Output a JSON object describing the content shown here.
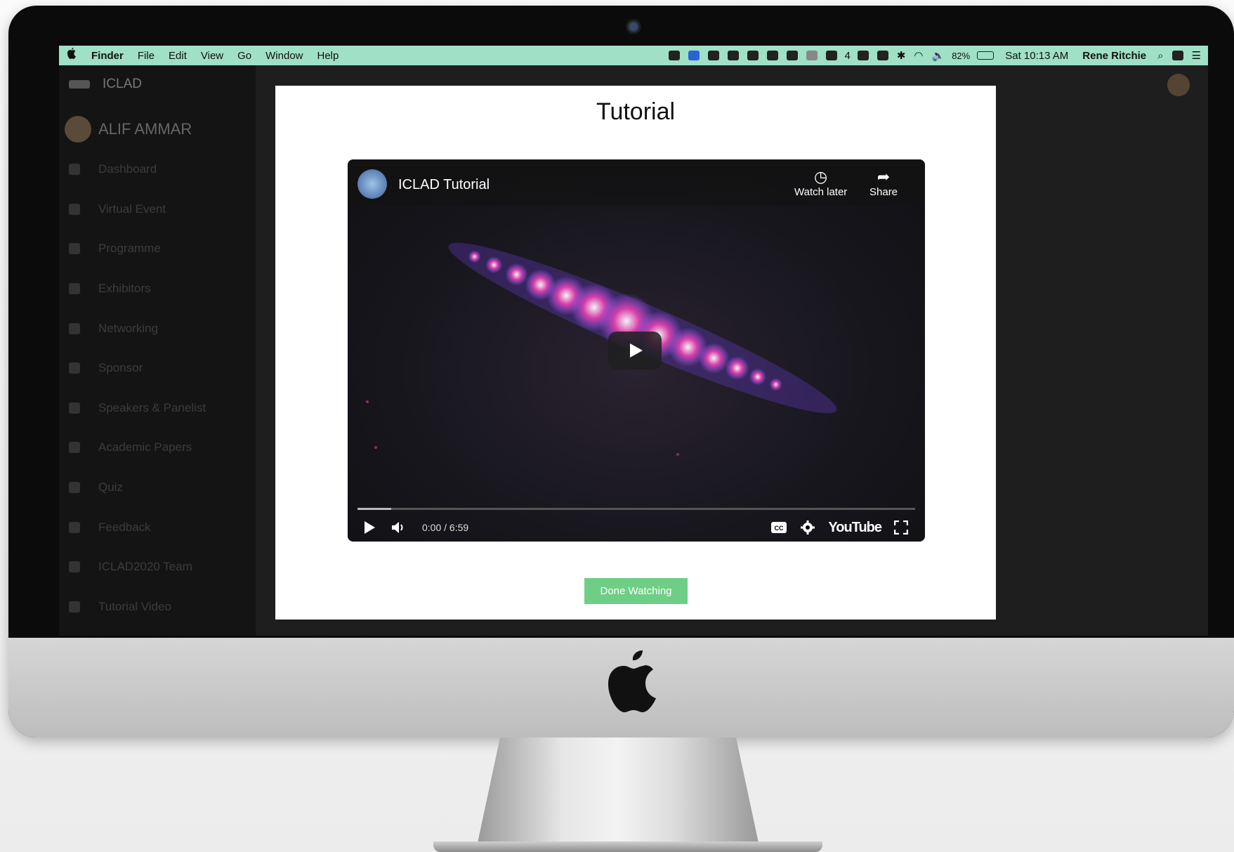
{
  "menubar": {
    "apple": "",
    "items": [
      "Finder",
      "File",
      "Edit",
      "View",
      "Go",
      "Window",
      "Help"
    ],
    "status": {
      "adobe_count": "4",
      "battery": "82%",
      "datetime": "Sat 10:13 AM",
      "user": "Rene Ritchie"
    }
  },
  "app": {
    "brand": "ICLAD",
    "user_name": "ALIF AMMAR",
    "nav": [
      "Dashboard",
      "Virtual Event",
      "Programme",
      "Exhibitors",
      "Networking",
      "Sponsor",
      "Speakers & Panelist",
      "Academic Papers",
      "Quiz",
      "Feedback",
      "ICLAD2020 Team",
      "Tutorial Video"
    ]
  },
  "modal": {
    "title": "Tutorial",
    "done_label": "Done Watching"
  },
  "player": {
    "title": "ICLAD Tutorial",
    "watch_later": "Watch later",
    "share": "Share",
    "time": "0:00 / 6:59",
    "youtube": "YouTube",
    "progress_fraction": 0.06
  },
  "colors": {
    "menubar": "#9fe0c6",
    "done_button": "#6fce86",
    "visual_pink": "#e23fb0",
    "visual_violet": "#8c5cff"
  }
}
